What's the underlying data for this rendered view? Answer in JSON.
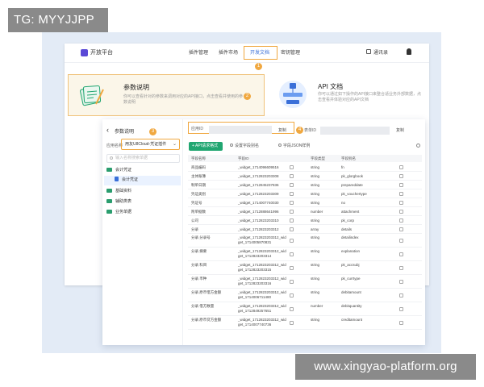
{
  "watermarks": {
    "top_left": "TG: MYYJJPP",
    "bottom_right": "www.xingyao-platform.org"
  },
  "topbar": {
    "brand": "开放平台",
    "nav": [
      "插件管理",
      "插件市场",
      "开发文档",
      "密钥管理"
    ],
    "active_nav": "开发文档",
    "right_item": "通讯录"
  },
  "badges": [
    "1",
    "2",
    "3",
    "4"
  ],
  "card_docs": {
    "title": "参数说明",
    "desc": "你可以查看针对的参数来调用对应的API接口，点击查看并使用的参数说明"
  },
  "card_api": {
    "title": "API 文档",
    "desc": "你可以通过如下操作的API接口来整合适业务外部数据，点击查看并体验对应的API文档"
  },
  "left_pane": {
    "title": "参数说明",
    "app_label": "应用名称",
    "app_value": "用友U8Cloud-凭证插件",
    "search_placeholder": "输入名称搜索单据",
    "tree": [
      {
        "label": "会计凭证",
        "type": "folder"
      },
      {
        "label": "会计凭证",
        "type": "doc"
      },
      {
        "label": "基础资料",
        "type": "folder"
      },
      {
        "label": "辅助类表",
        "type": "folder"
      },
      {
        "label": "业务单据",
        "type": "folder"
      }
    ]
  },
  "fields": {
    "app_id_label": "应用ID",
    "form_id_label": "表单ID",
    "copy": "复制"
  },
  "tabs": {
    "api": "API请求格式",
    "settings": "设置字段别名",
    "json": "字段JSON样例"
  },
  "table": {
    "headers": [
      "字段名称",
      "字段ID",
      "字段类型",
      "字段别名"
    ],
    "rows": [
      [
        "商品编码",
        "_widget_1714096609516",
        "string",
        "fn"
      ],
      [
        "主体账簿",
        "_widget_1712823203308",
        "string",
        "pk_glorgbook"
      ],
      [
        "制单日期",
        "_widget_1712845237836",
        "string",
        "prepareddate"
      ],
      [
        "凭证类别",
        "_widget_1712823203309",
        "string",
        "pk_vouchertype"
      ],
      [
        "凭证号",
        "_widget_1714007740030",
        "string",
        "no"
      ],
      [
        "附单据数",
        "_widget_1712888641996",
        "number",
        "attachment"
      ],
      [
        "公司",
        "_widget_1712823203310",
        "string",
        "pk_corp"
      ],
      [
        "分录",
        "_widget_1712823203312",
        "array",
        "details"
      ],
      [
        "分录.分录号",
        "_widget_1712823203312_widget_1714005870831",
        "string",
        "detailindex"
      ],
      [
        "分录.摘要",
        "_widget_1712823203312_widget_1712823203314",
        "string",
        "explanation"
      ],
      [
        "分录.科目",
        "_widget_1712823203312_widget_1712823203315",
        "string",
        "pk_accsubj"
      ],
      [
        "分录.币种",
        "_widget_1712823203312_widget_1712823203316",
        "string",
        "pk_currtype"
      ],
      [
        "分录.原币借方金额",
        "_widget_1712823203312_widget_1714006711480",
        "string",
        "debitamount"
      ],
      [
        "分录.借方数量",
        "_widget_1712823203312_widget_1712849257651",
        "number",
        "debitquantity"
      ],
      [
        "分录.原币贷方金额",
        "_widget_1712823203312_widget_1714007740736",
        "string",
        "creditamount"
      ]
    ]
  },
  "colors": {
    "accent": "#21a671",
    "highlight": "#f0a840",
    "brand": "#5a49d6",
    "link": "#3a6fd8"
  }
}
